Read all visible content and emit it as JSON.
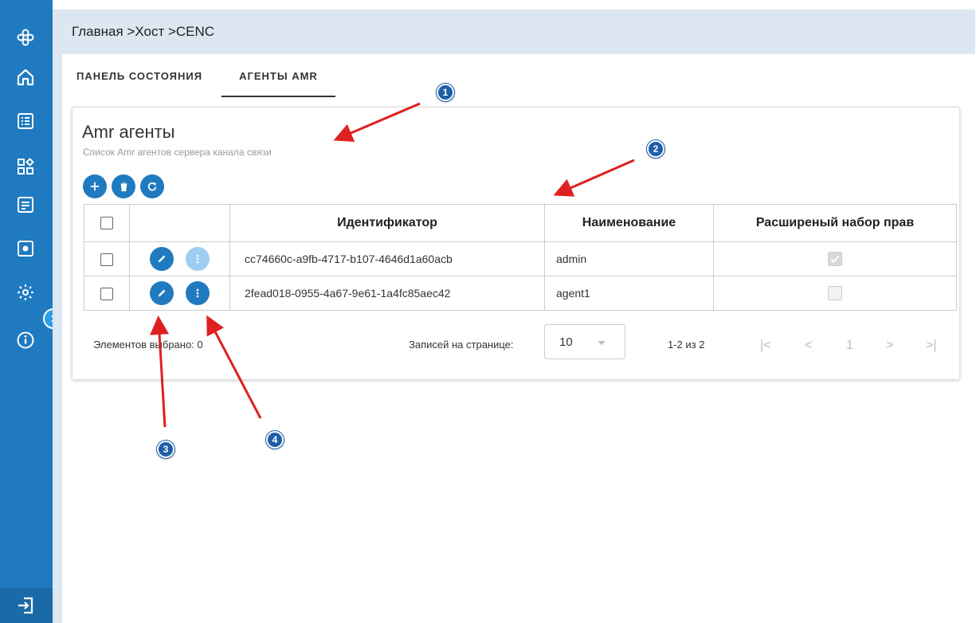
{
  "breadcrumb": "Главная >Хост >CENC",
  "sidebar": {
    "icons": [
      "logo-icon",
      "home-icon",
      "list-icon",
      "apps-icon",
      "document-icon",
      "plugin-icon",
      "settings-icon",
      "info-icon"
    ],
    "bottom_icon": "logout-icon"
  },
  "tabs": [
    {
      "label": "ПАНЕЛЬ СОСТОЯНИЯ",
      "active": false
    },
    {
      "label": "АГЕНТЫ AMR",
      "active": true
    }
  ],
  "card": {
    "title": "Amr агенты",
    "subtitle": "Список Amr агентов сервера канала связи"
  },
  "toolbar": [
    "add-icon",
    "delete-icon",
    "refresh-icon"
  ],
  "table": {
    "headers": [
      "",
      "",
      "Идентификатор",
      "Наименование",
      "Расширеный набор прав"
    ],
    "rows": [
      {
        "id": "cc74660c-a9fb-4717-b107-4646d1a60acb",
        "name": "admin",
        "extended": true
      },
      {
        "id": "2fead018-0955-4a67-9e61-1a4fc85aec42",
        "name": "agent1",
        "extended": false
      }
    ]
  },
  "footer": {
    "selected": "Элементов выбрано: 0",
    "per_page_label": "Записей на странице:",
    "per_page_value": "10",
    "range": "1-2 из 2",
    "page": "1"
  },
  "annotations": [
    "1",
    "2",
    "3",
    "4"
  ],
  "colors": {
    "sidebar": "#1f7ac0",
    "accent": "#1f7ac0",
    "arrow": "#e02020",
    "topbar": "#dde7f1"
  }
}
